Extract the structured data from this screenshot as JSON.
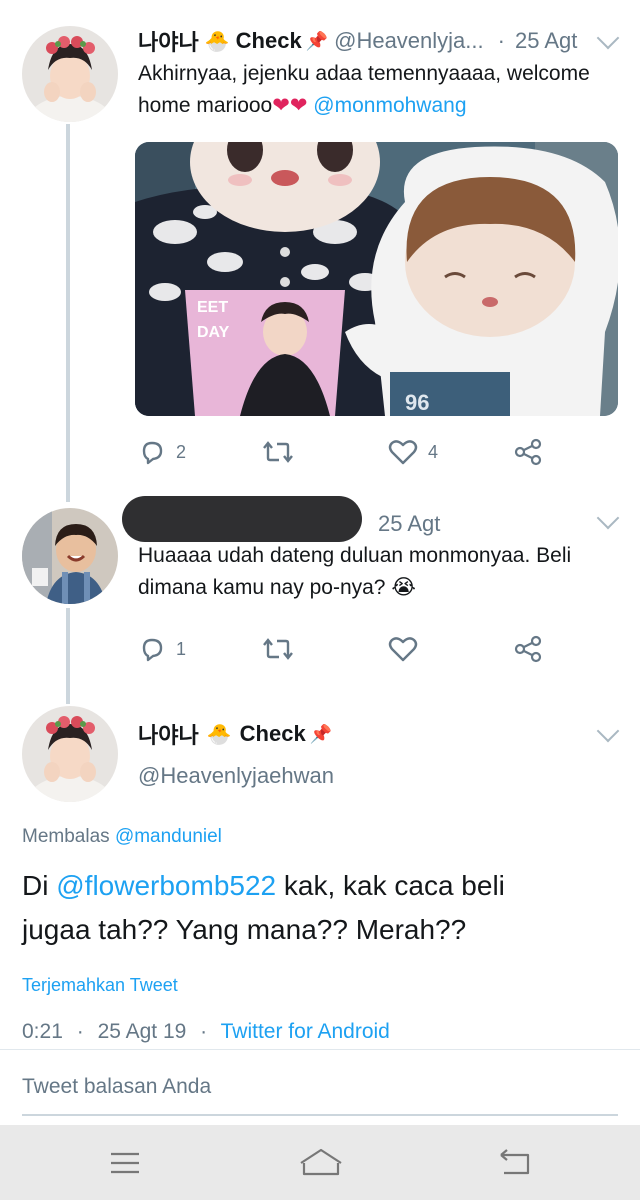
{
  "tweet1": {
    "name": "나야나",
    "emoji1": "🐣",
    "check": "Check",
    "emoji2": "📌",
    "handle": "@Heavenlyja...",
    "sep": "·",
    "date": "25 Agt",
    "text_line1": "Akhirnyaa, jejenku adaa temennyaaaa, welcome",
    "text_line2_plain": "home mariooo",
    "text_hearts": "❤❤",
    "mention": "@monmohwang",
    "reply_count": "2",
    "like_count": "4"
  },
  "tweet2": {
    "date": "25 Agt",
    "text_line1": "Huaaaa udah dateng duluan monmonyaa. Beli",
    "text_line2": "dimana kamu nay po-nya?",
    "emoji": "😭",
    "reply_count": "1"
  },
  "tweet3": {
    "name": "나야나",
    "emoji1": "🐣",
    "check": "Check",
    "emoji2": "📌",
    "handle": "@Heavenlyjaehwan",
    "replying_label": "Membalas",
    "replying_to": "@manduniel",
    "text_pre": "Di ",
    "mention": "@flowerbomb522",
    "text_post": " kak, kak caca beli",
    "text_line2": "jugaa tah?? Yang mana?? Merah??",
    "translate": "Terjemahkan Tweet",
    "time": "0:21",
    "sep": "·",
    "date": "25 Agt 19",
    "source": "Twitter for Android"
  },
  "reply_box": {
    "placeholder": "Tweet balasan Anda"
  },
  "colors": {
    "accent": "#1da1f2",
    "muted": "#657786",
    "heart": "#e0245e"
  }
}
